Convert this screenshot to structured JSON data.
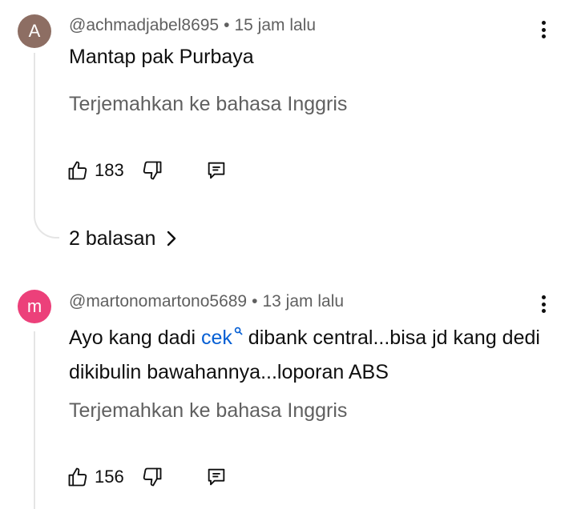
{
  "comments": [
    {
      "avatar_letter": "A",
      "avatar_color": "#8d6e63",
      "handle": "@achmadjabel8695",
      "separator": "•",
      "time": "15 jam lalu",
      "text": "Mantap pak Purbaya",
      "translate_label": "Terjemahkan ke bahasa Inggris",
      "likes": "183",
      "replies_label": "2 balasan"
    },
    {
      "avatar_letter": "m",
      "avatar_color": "#ec407a",
      "handle": "@martonomartono5689",
      "separator": "•",
      "time": "13 jam lalu",
      "text_before": "Ayo kang dadi ",
      "mention": "cek",
      "mention_icon": "search-icon",
      "text_after": " dibank central...bisa jd kang dedi dikibulin bawahannya...loporan ABS",
      "translate_label": "Terjemahkan ke bahasa Inggris",
      "likes": "156"
    }
  ],
  "icons": {
    "like": "thumbs-up-icon",
    "dislike": "thumbs-down-icon",
    "reply": "reply-comment-icon",
    "menu": "more-vertical-icon",
    "chevron": "chevron-right-icon"
  },
  "colors": {
    "link": "#065fd4",
    "secondary_text": "#606060",
    "thread_line": "#e5e5e5"
  }
}
